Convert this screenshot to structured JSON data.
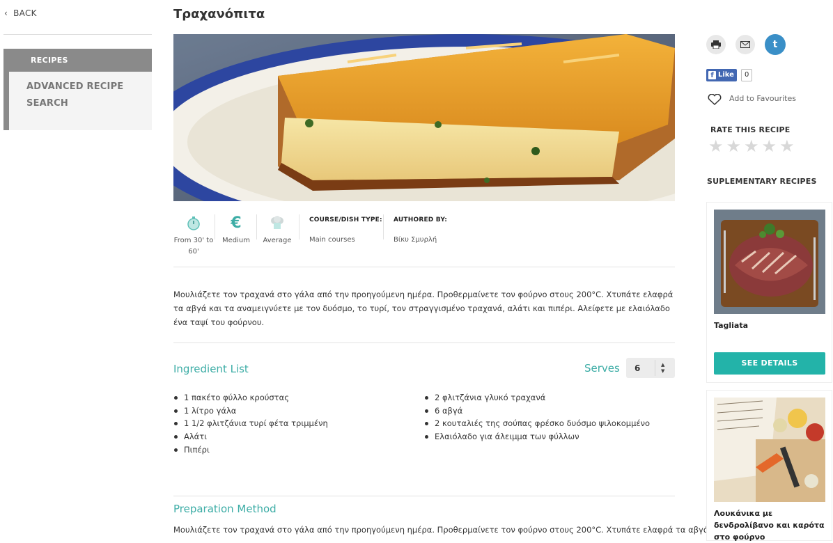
{
  "sidebar": {
    "back_label": "BACK",
    "recipes_label": "RECIPES",
    "advanced_search_label": "ADVANCED RECIPE SEARCH"
  },
  "recipe": {
    "title": "Τραχανόπιτα",
    "meta": {
      "time": "From 30' to 60'",
      "cost": "Medium",
      "difficulty": "Average",
      "course_heading": "COURSE/DISH TYPE:",
      "course_value": "Main courses",
      "author_heading": "AUTHORED BY:",
      "author_value": "Βίκυ Σμυρλή"
    },
    "intro": "Μουλιάζετε τον τραχανά στο γάλα από την προηγούμενη ημέρα. Προθερμαίνετε τον φούρνο στους 200°C. Χτυπάτε ελαφρά τα αβγά και τα αναμειγνύετε με τον δυόσμο, το τυρί, τον στραγγισμένο τραχανά, αλάτι και πιπέρι. Αλείφετε με ελαιόλαδο ένα ταψί του φούρνου.",
    "ingredients_title": "Ingredient List",
    "serves_label": "Serves",
    "serves_value": "6",
    "ingredients_left": [
      "1 πακέτο φύλλο κρούστας",
      "1 λίτρο γάλα",
      "1 1/2 φλιτζάνια τυρί φέτα τριμμένη",
      "Αλάτι",
      "Πιπέρι"
    ],
    "ingredients_right": [
      "2 φλιτζάνια γλυκό τραχανά",
      "6 αβγά",
      "2 κουταλιές της σούπας φρέσκο δυόσμο ψιλοκομμένο",
      "Ελαιόλαδο για άλειμμα των φύλλων"
    ],
    "preparation_title": "Preparation Method",
    "preparation_text": "Μουλιάζετε τον τραχανά στο γάλα από την προηγούμενη ημέρα. Προθερμαίνετε τον φούρνο στους 200°C. Χτυπάτε ελαφρά τα αβγά και τα"
  },
  "actions": {
    "like_label": "Like",
    "like_count": "0",
    "favourites_label": "Add to Favourites",
    "rate_title": "RATE THIS RECIPE",
    "rating": 0,
    "max_rating": 5,
    "star_glyphs": "★★★★★"
  },
  "supplementary": {
    "title": "SUPLEMENTARY RECIPES",
    "items": [
      {
        "name": "Tagliata",
        "button_label": "SEE DETAILS"
      },
      {
        "name": "Λουκάνικα με δενδρολίβανο και καρότα στο φούρνο"
      }
    ]
  },
  "colors": {
    "accent": "#3dada6",
    "button": "#23b3a9",
    "sidebar_gray": "#8a8a8a",
    "twitter": "#3a8fc7",
    "facebook": "#4267b2"
  }
}
